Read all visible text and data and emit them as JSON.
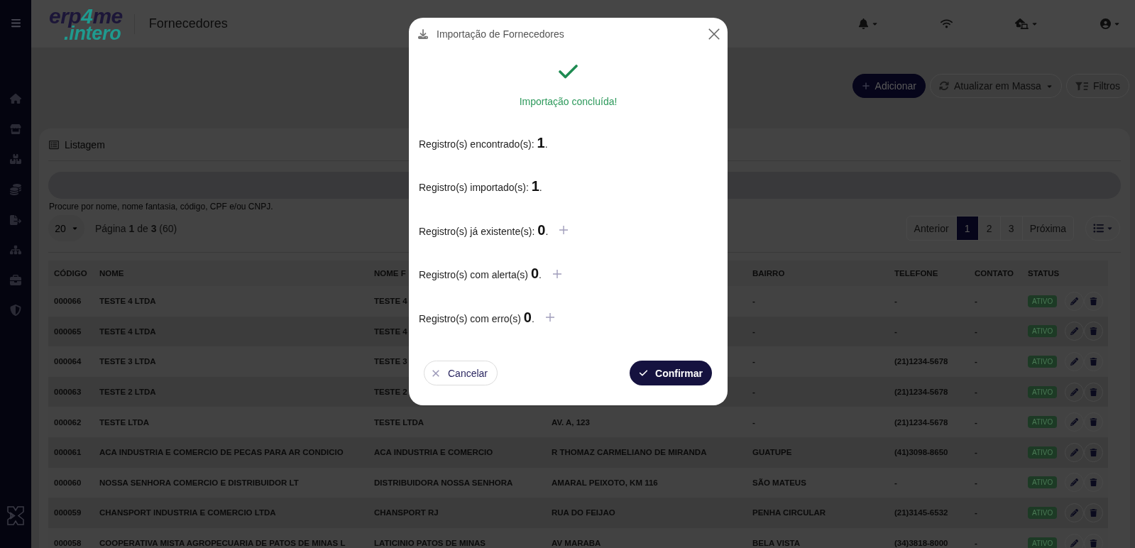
{
  "header": {
    "logo": {
      "prefix": "erp",
      "accent": "4",
      "suffix": "me",
      "tagline": ".intero"
    },
    "title": "Fornecedores"
  },
  "actions": [
    {
      "label": "Adicionar",
      "kind": "primary"
    },
    {
      "label": "Atualizar em Massa",
      "kind": "bulk"
    },
    {
      "label": "Filtros",
      "kind": "filter"
    }
  ],
  "listing": {
    "title": "Listagem",
    "search_hint": "Procure por nome, nome fantasia, código, CPF e/ou CNPJ.",
    "page_size": "20",
    "page_info": "Página **1** de **3** (60)",
    "pagination": [
      {
        "label": "Anterior",
        "selected": false
      },
      {
        "label": "1",
        "selected": true
      },
      {
        "label": "2",
        "selected": false
      },
      {
        "label": "3",
        "selected": false
      },
      {
        "label": "Próxima",
        "selected": false
      }
    ]
  },
  "table": {
    "columns": [
      "CÓDIGO",
      "NOME",
      "NOME F",
      null,
      "BAIRRO",
      "TELEFONE",
      "CONTATO",
      "STATUS"
    ],
    "rows": [
      {
        "cells": [
          "000066",
          "TESTE 4 LTDA",
          "TESTE 4",
          null,
          "-",
          "-",
          "-"
        ],
        "status": "ATIVO"
      },
      {
        "cells": [
          "000065",
          "TESTE 4 LTDA",
          "TESTE 4",
          null,
          "-",
          "-",
          "-"
        ],
        "status": "ATIVO"
      },
      {
        "cells": [
          "000064",
          "TESTE 3 LTDA",
          "TESTE 3",
          null,
          "-",
          "(21)1234-5678",
          "-"
        ],
        "status": "ATIVO"
      },
      {
        "cells": [
          "000063",
          "TESTE 2 LTDA",
          "TESTE 2",
          null,
          "-",
          "(21)1234-5678",
          "-"
        ],
        "status": "ATIVO"
      },
      {
        "cells": [
          "000062",
          "TESTE LTDA",
          "TESTE LTDA",
          "AV. A, 123",
          "-",
          "(21)1234-5678",
          "-"
        ],
        "status": "ATIVO"
      },
      {
        "cells": [
          "000061",
          "ACA INDUSTRIA E COMERCIO DE PECAS PARA AR CONDICIO",
          "ACA INDUSTRIA E COMERCIO",
          "R THOMAZ CARMELIANO DE MIRANDA",
          "GUATUPE",
          "(41)3098-8650",
          "-"
        ],
        "status": "ATIVO"
      },
      {
        "cells": [
          "000060",
          "NOSSA SENHORA COMERCIO E DISTRIBUIDOR LT",
          "DISTRIBUIDORA NOSSA SENHORA",
          "AMARAL PEIXOTO, KM 116",
          "SÃO MATEUS",
          "-",
          "-"
        ],
        "status": "ATIVO"
      },
      {
        "cells": [
          "000059",
          "CHANSPORT INDUSTRIA E COMERCIO LTDA",
          "CHANSPORT RJ",
          "RUA DO FEIJAO",
          "PENHA CIRCULAR",
          "(21)3145-6532",
          "-"
        ],
        "status": "ATIVO"
      },
      {
        "cells": [
          "000058",
          "COOPERATIVA MISTA AGROPECUARIA DE PATOS DE MINAS L",
          "LATICINIO PATOS DE MINAS",
          "AV MARABA",
          "BELA VISTA",
          "(34)3818-8000",
          "-"
        ],
        "status": "ATIVO"
      }
    ]
  },
  "dialog": {
    "title": "Importação de Fornecedores",
    "status": "Importação concluída!",
    "results": [
      {
        "text": "Registro(s) encontrado(s): **1**.",
        "expandable": false
      },
      {
        "text": "Registro(s) importado(s): **1**.",
        "expandable": false
      },
      {
        "text": "Registro(s) já existente(s): **0**.",
        "expandable": true
      },
      {
        "text": "Registro(s) com alerta(s) **0**.",
        "expandable": true
      },
      {
        "text": "Registro(s) com erro(s) **0**.",
        "expandable": true
      }
    ],
    "buttons": [
      {
        "label": "Cancelar",
        "kind": "cancel"
      },
      {
        "label": "Confirmar",
        "kind": "confirm"
      }
    ]
  }
}
